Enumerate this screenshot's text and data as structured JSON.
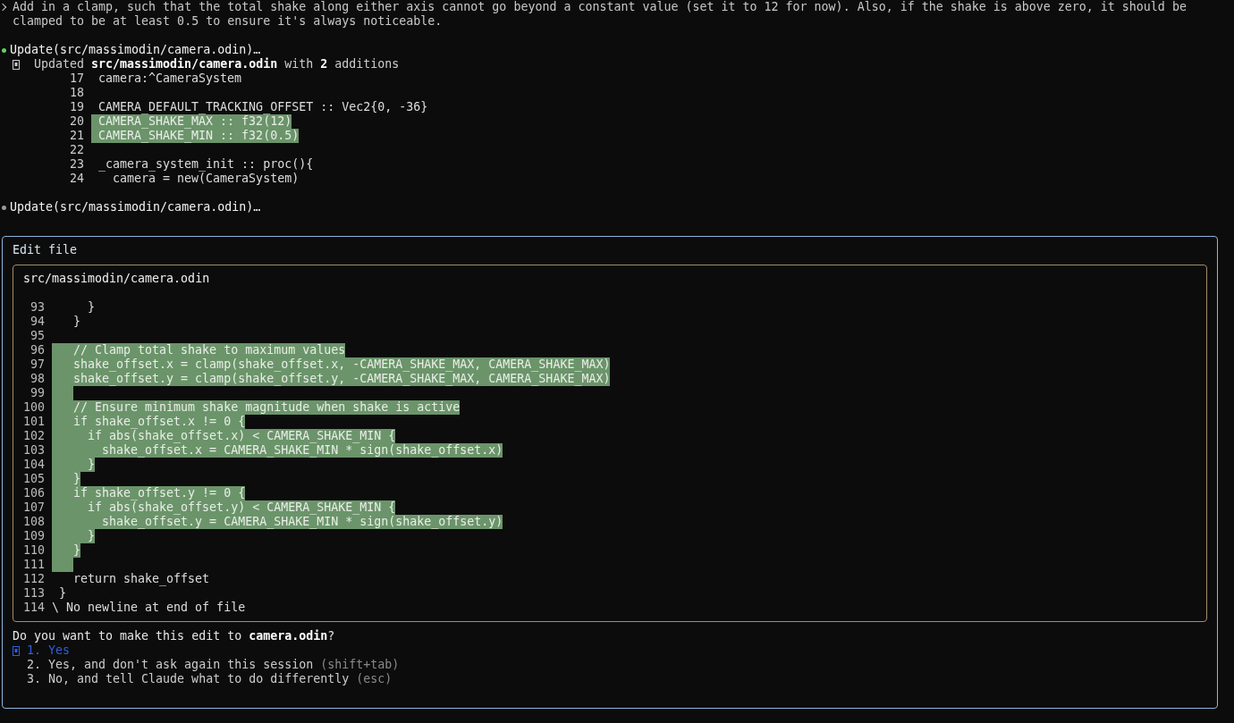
{
  "prompt": {
    "lines": [
      "Add in a clamp, such that the total shake along either axis cannot go beyond a constant value (set it to 12 for now). Also, if the shake is above zero, it should be",
      "clamped to be at least 0.5 to ensure it's always noticeable."
    ]
  },
  "tool_calls": [
    {
      "color": "#5fd35f",
      "title": "Update(src/massimodin/camera.odin)…",
      "result": "Updated **src/massimodin/camera.odin** with **2** additions",
      "diff": [
        {
          "number": "17",
          "code": " camera:^CameraSystem",
          "added": false
        },
        {
          "number": "18",
          "added": false
        },
        {
          "number": "19",
          "code": " CAMERA_DEFAULT_TRACKING_OFFSET :: Vec2{0, -36}",
          "added": false
        },
        {
          "number": "20",
          "code": " CAMERA_SHAKE_MAX :: f32(12)",
          "added": true
        },
        {
          "number": "21",
          "code": " CAMERA_SHAKE_MIN :: f32(0.5)",
          "added": true
        },
        {
          "number": "22",
          "added": false
        },
        {
          "number": "23",
          "code": " _camera_system_init :: proc(){",
          "added": false
        },
        {
          "number": "24",
          "code": "   camera = new(CameraSystem)",
          "added": false
        }
      ]
    },
    {
      "color": "#9a9a9a",
      "title": "Update(src/massimodin/camera.odin)…"
    }
  ],
  "edit_dialog": {
    "title": "Edit file",
    "file_path": "src/massimodin/camera.odin",
    "diff": [
      {
        "number": "93",
        "code": "     }",
        "added": false
      },
      {
        "number": "94",
        "code": "   }",
        "added": false
      },
      {
        "number": "95",
        "added": false
      },
      {
        "number": "96",
        "code": "   // Clamp total shake to maximum values",
        "added": true
      },
      {
        "number": "97",
        "code": "   shake_offset.x = clamp(shake_offset.x, -CAMERA_SHAKE_MAX, CAMERA_SHAKE_MAX)",
        "added": true
      },
      {
        "number": "98",
        "code": "   shake_offset.y = clamp(shake_offset.y, -CAMERA_SHAKE_MAX, CAMERA_SHAKE_MAX)",
        "added": true
      },
      {
        "number": "99",
        "added": true
      },
      {
        "number": "100",
        "code": "   // Ensure minimum shake magnitude when shake is active",
        "added": true
      },
      {
        "number": "101",
        "code": "   if shake_offset.x != 0 {",
        "added": true
      },
      {
        "number": "102",
        "code": "     if abs(shake_offset.x) < CAMERA_SHAKE_MIN {",
        "added": true
      },
      {
        "number": "103",
        "code": "       shake_offset.x = CAMERA_SHAKE_MIN * sign(shake_offset.x)",
        "added": true
      },
      {
        "number": "104",
        "code": "     }",
        "added": true
      },
      {
        "number": "105",
        "code": "   }",
        "added": true
      },
      {
        "number": "106",
        "code": "   if shake_offset.y != 0 {",
        "added": true
      },
      {
        "number": "107",
        "code": "     if abs(shake_offset.y) < CAMERA_SHAKE_MIN {",
        "added": true
      },
      {
        "number": "108",
        "code": "       shake_offset.y = CAMERA_SHAKE_MIN * sign(shake_offset.y)",
        "added": true
      },
      {
        "number": "109",
        "code": "     }",
        "added": true
      },
      {
        "number": "110",
        "code": "   }",
        "added": true
      },
      {
        "number": "111",
        "added": true
      },
      {
        "number": "112",
        "code": "   return shake_offset",
        "added": false
      },
      {
        "number": "113",
        "code": " }",
        "added": false
      },
      {
        "number": "114",
        "code": "\\ No newline at end of file",
        "added": false
      }
    ],
    "question": "Do you want to make this edit to **camera.odin**?",
    "options": [
      {
        "label": "1. Yes",
        "selected": true
      },
      {
        "label": "2. Yes, and don't ask again this session",
        "hint": "(shift+tab)",
        "selected": false
      },
      {
        "label": "3. No, and tell Claude what to do differently",
        "hint": "(esc)",
        "selected": false
      }
    ]
  }
}
